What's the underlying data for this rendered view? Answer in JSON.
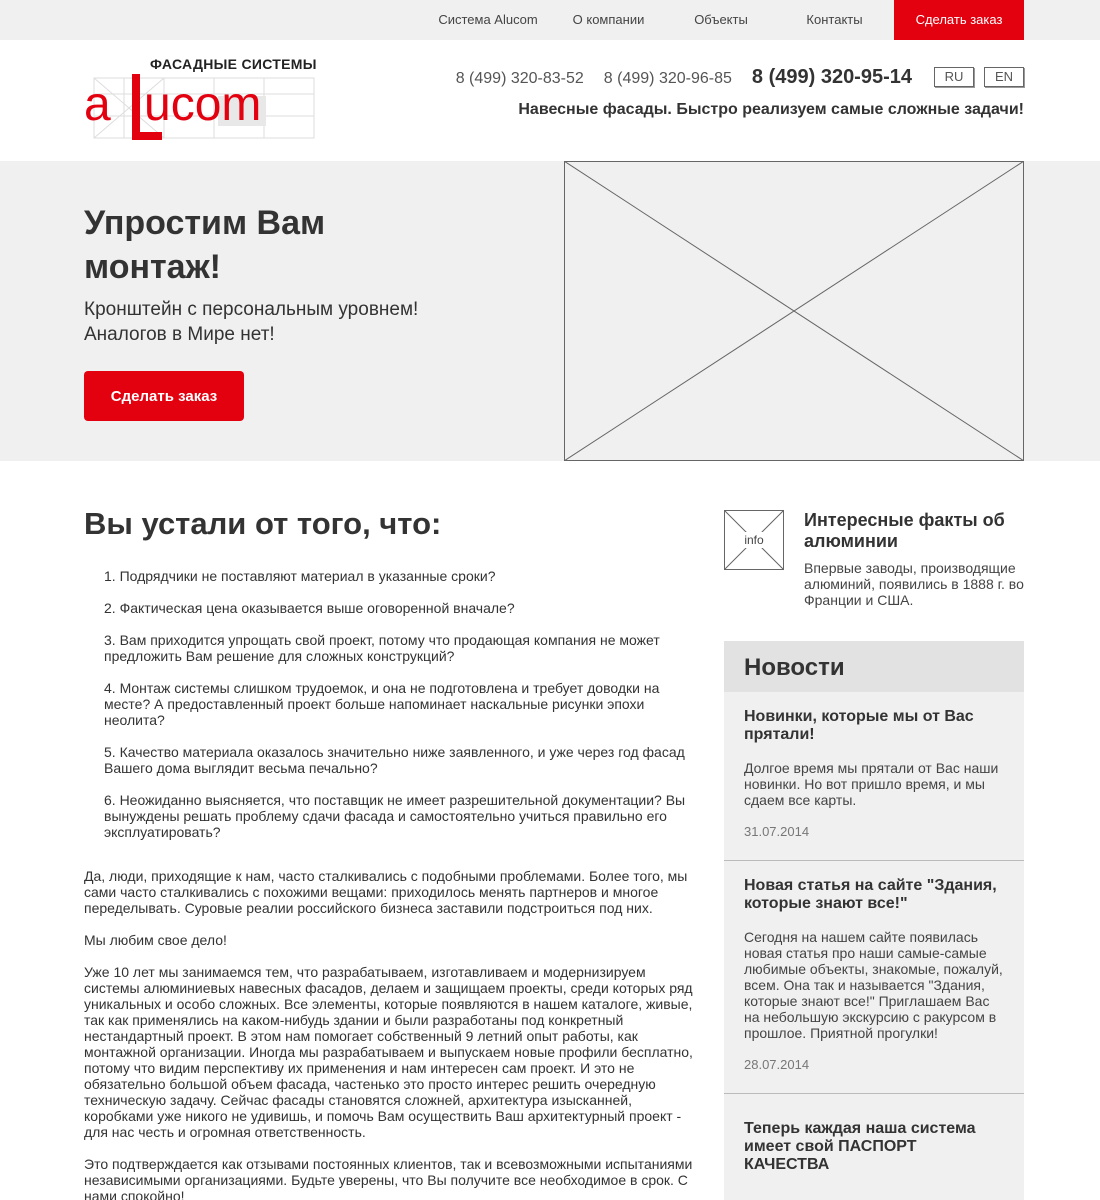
{
  "topnav": {
    "items": [
      "Система Alucom",
      "О компании",
      "Объекты",
      "Контакты"
    ],
    "cta": "Сделать заказ"
  },
  "logo": {
    "subtitle": "ФАСАДНЫЕ СИСТЕМЫ",
    "wordmark": "alucom",
    "brand_color": "#e3000f"
  },
  "header": {
    "phones": [
      "8 (499) 320-83-52",
      "8 (499) 320-96-85"
    ],
    "phone_main": "8 (499) 320-95-14",
    "languages": [
      "RU",
      "EN"
    ],
    "tagline": "Навесные фасады. Быстро реализуем самые сложные задачи!"
  },
  "hero": {
    "title": "Упростим Вам монтаж!",
    "subtitle_line1": "Кронштейн с персональным уровнем!",
    "subtitle_line2": "Аналогов в Мире нет!",
    "button": "Сделать заказ",
    "image_icon": "image-placeholder-icon"
  },
  "main": {
    "title": "Вы устали от того, что:",
    "problems": [
      "1. Подрядчики не поставляют материал в указанные сроки?",
      "2. Фактическая цена оказывается выше оговоренной вначале?",
      "3. Вам приходится упрощать свой проект, потому что продающая компания не может предложить Вам решение для сложных конструкций?",
      "4. Монтаж системы слишком трудоемок, и она не подготовлена и требует доводки на месте? А предоставленный проект больше напоминает наскальные рисунки эпохи неолита?",
      "5. Качество материала оказалось значительно ниже заявленного, и уже через год фасад Вашего дома выглядит весьма печально?",
      "6. Неожиданно выясняется, что поставщик не имеет разрешительной документации? Вы вынуждены решать проблему сдачи фасада и самостоятельно учиться правильно его эксплуатировать?"
    ],
    "paragraphs": [
      "Да, люди, приходящие к нам, часто сталкивались с подобными проблемами. Более того, мы сами часто сталкивались с похожими вещами: приходилось менять партнеров и многое переделывать. Суровые реалии российского бизнеса заставили подстроиться под них.",
      "Мы любим свое дело!",
      "Уже 10 лет мы занимаемся тем, что разрабатываем, изготавливаем и модернизируем системы алюминиевых навесных фасадов, делаем и защищаем проекты, среди которых ряд уникальных и особо сложных. Все элементы, которые появляются в нашем каталоге, живые, так как применялись на каком-нибудь здании и были разработаны под конкретный нестандартный проект. В этом нам помогает собственный 9 летний опыт работы, как монтажной организации. Иногда мы разрабатываем и выпускаем новые профили бесплатно, потому что видим перспективу их применения и нам интересен сам проект. И это не обязательно большой объем фасада, частенько это просто интерес решить очередную техническую задачу. Сейчас фасады становятся сложней, архитектура изысканней, коробками уже никого не удивишь, и помочь Вам осуществить Ваш архитектурный проект - для нас честь и огромная ответственность.",
      "Это подтверждается как отзывами постоянных клиентов, так и всевозможными испытаниями независимыми организациями. Будьте уверены, что Вы получите все необходимое в срок. С нами спокойно!"
    ]
  },
  "fact": {
    "icon_label": "info",
    "title": "Интересные факты об алюминии",
    "text": "Впервые заводы, производящие алюминий, появились в 1888 г. во Франции и США."
  },
  "news": {
    "heading": "Новости",
    "items": [
      {
        "title": "Новинки, которые мы от Вас прятали!",
        "text": "Долгое время мы прятали от Вас наши новинки. Но вот пришло время, и мы сдаем все карты.",
        "date": "31.07.2014"
      },
      {
        "title": "Новая статья на сайте \"Здания, которые знают все!\"",
        "text": "Сегодня на нашем сайте появилась новая статья про наши самые-самые любимые объекты, знакомые, пожалуй, всем. Она так и называется \"Здания, которые знают все!\" Приглашаем Вас на небольшую экскурсию с ракурсом в прошлое. Приятной прогулки!",
        "date": "28.07.2014"
      },
      {
        "title": "Теперь каждая наша система имеет свой ПАСПОРТ КАЧЕСТВА"
      }
    ]
  }
}
